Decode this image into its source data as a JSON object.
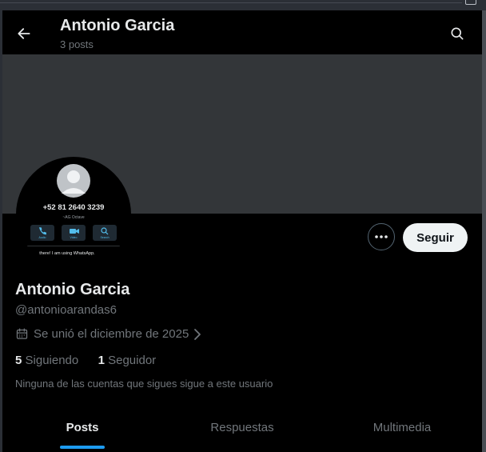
{
  "header": {
    "title": "Antonio Garcia",
    "subtitle": "3 posts"
  },
  "avatar_image": {
    "phone": "+52 81 2640 3239",
    "sublabel": "~AG Octave",
    "actions": [
      "Audio",
      "Video",
      "Search"
    ],
    "status": "there! I am using WhatsApp."
  },
  "actions": {
    "more_icon": "more-horizontal-icon",
    "follow_label": "Seguir"
  },
  "profile": {
    "name": "Antonio Garcia",
    "handle": "@antonioarandas6",
    "joined": "Se unió el diciembre de 2025",
    "following_count": "5",
    "following_label": "Siguiendo",
    "followers_count": "1",
    "followers_label": "Seguidor",
    "note": "Ninguna de las cuentas que sigues sigue a este usuario"
  },
  "tabs": [
    {
      "label": "Posts",
      "active": true
    },
    {
      "label": "Respuestas",
      "active": false
    },
    {
      "label": "Multimedia",
      "active": false
    }
  ],
  "colors": {
    "background": "#000000",
    "banner": "#333639",
    "accent": "#1d9bf0",
    "secondary_text": "#71767b",
    "primary_text": "#e7e9ea"
  }
}
